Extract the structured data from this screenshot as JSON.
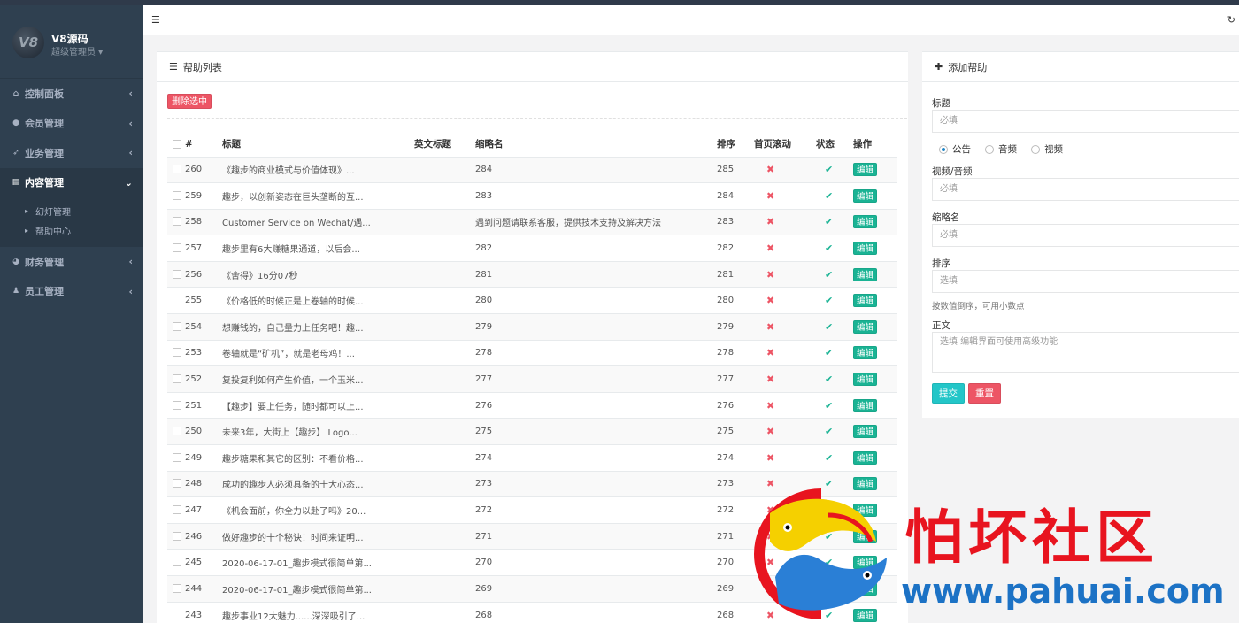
{
  "sidebar": {
    "logo_text": "V8",
    "brand": "V8源码",
    "role": "超级管理员 ▾",
    "items": [
      {
        "label": "控制面板",
        "icon": "home-icon"
      },
      {
        "label": "会员管理",
        "icon": "user-icon"
      },
      {
        "label": "业务管理",
        "icon": "rocket-icon"
      },
      {
        "label": "内容管理",
        "icon": "book-icon",
        "active": true
      },
      {
        "label": "财务管理",
        "icon": "pie-chart-icon"
      },
      {
        "label": "员工管理",
        "icon": "staff-icon"
      }
    ],
    "submenu": [
      {
        "label": "幻灯管理"
      },
      {
        "label": "帮助中心"
      }
    ]
  },
  "list_panel": {
    "title": "帮助列表",
    "delete_button": "删除选中",
    "columns": [
      "#",
      "标题",
      "英文标题",
      "缩略名",
      "排序",
      "首页滚动",
      "状态",
      "操作"
    ],
    "edit_label": "编辑",
    "rows": [
      {
        "id": "260",
        "title": "《趣步的商业模式与价值体现》...",
        "en_title": "",
        "slug": "284",
        "sort": "285",
        "scroll": false,
        "status": true
      },
      {
        "id": "259",
        "title": "趣步，以创新姿态在巨头垄断的互...",
        "en_title": "",
        "slug": "283",
        "sort": "284",
        "scroll": false,
        "status": true
      },
      {
        "id": "258",
        "title": "Customer Service on Wechat/遇...",
        "en_title": "",
        "slug": "遇到问题请联系客服，提供技术支持及解决方法",
        "sort": "283",
        "scroll": false,
        "status": true
      },
      {
        "id": "257",
        "title": "趣步里有6大赚糖果通道，以后会...",
        "en_title": "",
        "slug": "282",
        "sort": "282",
        "scroll": false,
        "status": true
      },
      {
        "id": "256",
        "title": "《舍得》16分07秒",
        "en_title": "",
        "slug": "281",
        "sort": "281",
        "scroll": false,
        "status": true
      },
      {
        "id": "255",
        "title": "《价格低的时候正是上卷轴的时候...",
        "en_title": "",
        "slug": "280",
        "sort": "280",
        "scroll": false,
        "status": true
      },
      {
        "id": "254",
        "title": "想赚钱的，自己量力上任务吧！趣...",
        "en_title": "",
        "slug": "279",
        "sort": "279",
        "scroll": false,
        "status": true
      },
      {
        "id": "253",
        "title": "卷轴就是“矿机”，就是老母鸡！...",
        "en_title": "",
        "slug": "278",
        "sort": "278",
        "scroll": false,
        "status": true
      },
      {
        "id": "252",
        "title": "复投复利如何产生价值，一个玉米...",
        "en_title": "",
        "slug": "277",
        "sort": "277",
        "scroll": false,
        "status": true
      },
      {
        "id": "251",
        "title": "【趣步】要上任务，随时都可以上...",
        "en_title": "",
        "slug": "276",
        "sort": "276",
        "scroll": false,
        "status": true
      },
      {
        "id": "250",
        "title": "未来3年，大街上【趣步】 Logo...",
        "en_title": "",
        "slug": "275",
        "sort": "275",
        "scroll": false,
        "status": true
      },
      {
        "id": "249",
        "title": "趣步糖果和其它的区别：不看价格...",
        "en_title": "",
        "slug": "274",
        "sort": "274",
        "scroll": false,
        "status": true
      },
      {
        "id": "248",
        "title": "成功的趣步人必须具备的十大心态...",
        "en_title": "",
        "slug": "273",
        "sort": "273",
        "scroll": false,
        "status": true
      },
      {
        "id": "247",
        "title": "《机会面前，你全力以赴了吗》20...",
        "en_title": "",
        "slug": "272",
        "sort": "272",
        "scroll": false,
        "status": true
      },
      {
        "id": "246",
        "title": "做好趣步的十个秘诀！时间来证明...",
        "en_title": "",
        "slug": "271",
        "sort": "271",
        "scroll": false,
        "status": true
      },
      {
        "id": "245",
        "title": "2020-06-17-01_趣步模式很简单第...",
        "en_title": "",
        "slug": "270",
        "sort": "270",
        "scroll": false,
        "status": true
      },
      {
        "id": "244",
        "title": "2020-06-17-01_趣步模式很简单第...",
        "en_title": "",
        "slug": "269",
        "sort": "269",
        "scroll": false,
        "status": true
      },
      {
        "id": "243",
        "title": "趣步事业12大魅力......深深吸引了...",
        "en_title": "",
        "slug": "268",
        "sort": "268",
        "scroll": false,
        "status": true
      }
    ]
  },
  "add_panel": {
    "title": "添加帮助",
    "title_label": "标题",
    "title_placeholder": "必填",
    "radio_options": [
      {
        "label": "公告",
        "checked": true
      },
      {
        "label": "音频",
        "checked": false
      },
      {
        "label": "视频",
        "checked": false
      }
    ],
    "media_label": "视频/音频",
    "media_placeholder": "必填",
    "slug_label": "缩略名",
    "slug_placeholder": "必填",
    "sort_label": "排序",
    "sort_placeholder": "选填",
    "sort_hint": "按数值倒序，可用小数点",
    "body_label": "正文",
    "body_placeholder": "选填 编辑界面可使用高级功能",
    "submit": "提交",
    "reset": "重置"
  },
  "watermark": {
    "title": "怕坏社区",
    "url": "www.pahuai.com"
  },
  "colors": {
    "sidebar_bg": "#2f4050",
    "success": "#1ab394",
    "danger": "#ed5565",
    "info": "#23c6c8"
  }
}
